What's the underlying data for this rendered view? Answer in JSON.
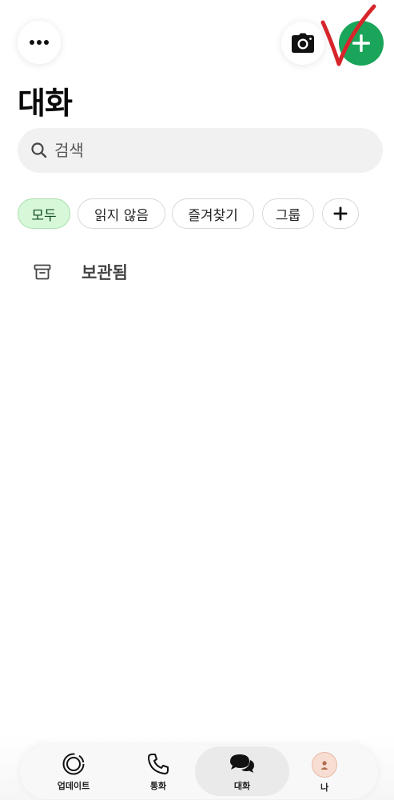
{
  "header": {
    "title": "대화",
    "more_icon": "more-horizontal-icon",
    "camera_icon": "camera-icon",
    "new_chat_icon": "plus-icon",
    "new_chat_color": "#1aa55a"
  },
  "search": {
    "placeholder": "검색",
    "icon": "search-icon"
  },
  "filters": {
    "items": [
      {
        "label": "모두",
        "active": true
      },
      {
        "label": "읽지 않음",
        "active": false
      },
      {
        "label": "즐겨찾기",
        "active": false
      },
      {
        "label": "그룹",
        "active": false
      }
    ],
    "add_icon": "plus-icon",
    "active_color": "#d7f7d9"
  },
  "archived": {
    "label": "보관됨",
    "icon": "archive-icon"
  },
  "bottom_nav": {
    "items": [
      {
        "label": "업데이트",
        "icon": "updates-icon"
      },
      {
        "label": "통화",
        "icon": "phone-icon"
      },
      {
        "label": "대화",
        "icon": "chats-icon",
        "active": true
      },
      {
        "label": "나",
        "icon": "avatar-icon"
      }
    ]
  }
}
